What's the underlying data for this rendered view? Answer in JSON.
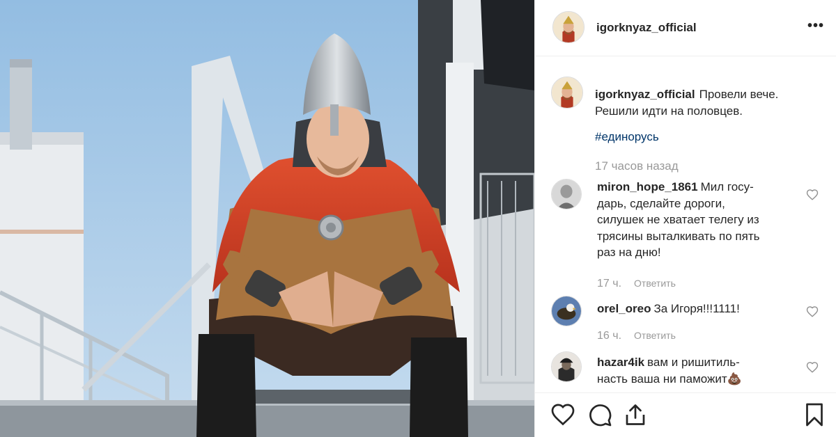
{
  "post": {
    "username": "igorknyaz_official",
    "more_label": "•••",
    "caption": "Провели вече. Решили идти на половцев.",
    "hashtag": "#единорусь",
    "time_ago": "17 часов назад"
  },
  "comments": [
    {
      "username": "miron_hope_1861",
      "text": "Мил госу­дарь, сделайте дороги, силушек не хватает телегу из трясины выталкивать по пять раз на дню!",
      "time": "17 ч.",
      "reply_label": "Ответить"
    },
    {
      "username": "orel_oreo",
      "text": "За Игоря!!!1111!",
      "time": "16 ч.",
      "reply_label": "Ответить"
    },
    {
      "username": "hazar4ik",
      "text": "вам и ришитиль­насть ваша ни паможит💩",
      "time": "",
      "reply_label": ""
    }
  ],
  "icons": {
    "like": "heart-icon",
    "comment": "comment-icon",
    "share": "share-icon",
    "save": "bookmark-icon",
    "more": "more-icon"
  },
  "colors": {
    "sky": "#9ec3e4",
    "cape": "#d8442a",
    "hashtag": "#003569",
    "muted": "#999999"
  }
}
